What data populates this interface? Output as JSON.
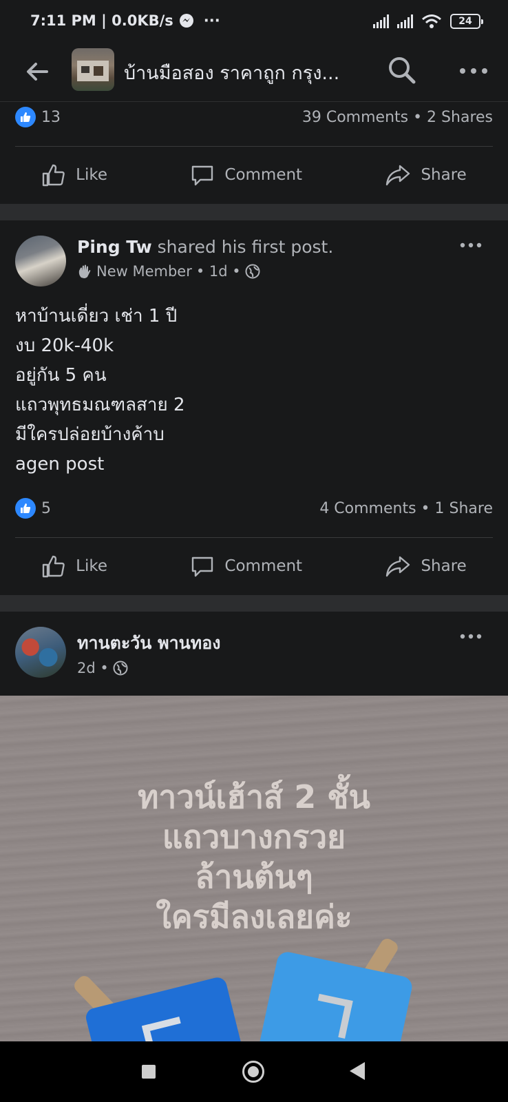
{
  "status_bar": {
    "time_speed": "7:11 PM | 0.0KB/s",
    "more": "···",
    "battery": "24"
  },
  "app_bar": {
    "title": "บ้านมือสอง ราคาถูก กรุง...",
    "more": "···"
  },
  "post_prev": {
    "like_count": "13",
    "stats": "39 Comments • 2 Shares",
    "actions": {
      "like": "Like",
      "comment": "Comment",
      "share": "Share"
    }
  },
  "post_ping": {
    "author": "Ping Tw",
    "action_text": " shared his first post.",
    "badge": "New Member",
    "time": "• 1d •",
    "text_lines": [
      "หาบ้านเดี่ยว เช่า 1 ปี",
      "งบ 20k-40k",
      "อยู่กัน 5 คน",
      "แถวพุทธมณฑลสาย 2",
      "มีใครปล่อยบ้างค้าบ",
      "agen post"
    ],
    "like_count": "5",
    "stats": "4 Comments • 1 Share",
    "actions": {
      "like": "Like",
      "comment": "Comment",
      "share": "Share"
    },
    "more": "···"
  },
  "post_thanta": {
    "author": "ทานตะวัน พานทอง",
    "time": "2d •",
    "more": "···",
    "image_caption": [
      "ทาวน์เฮ้าส์ 2 ชั้น",
      "แถวบางกรวย",
      "ล้านต้นๆ",
      "ใครมีลงเลยค่ะ"
    ]
  },
  "colors": {
    "accent": "#2d88ff",
    "background": "#18191a",
    "separator": "#2c2d2f"
  }
}
